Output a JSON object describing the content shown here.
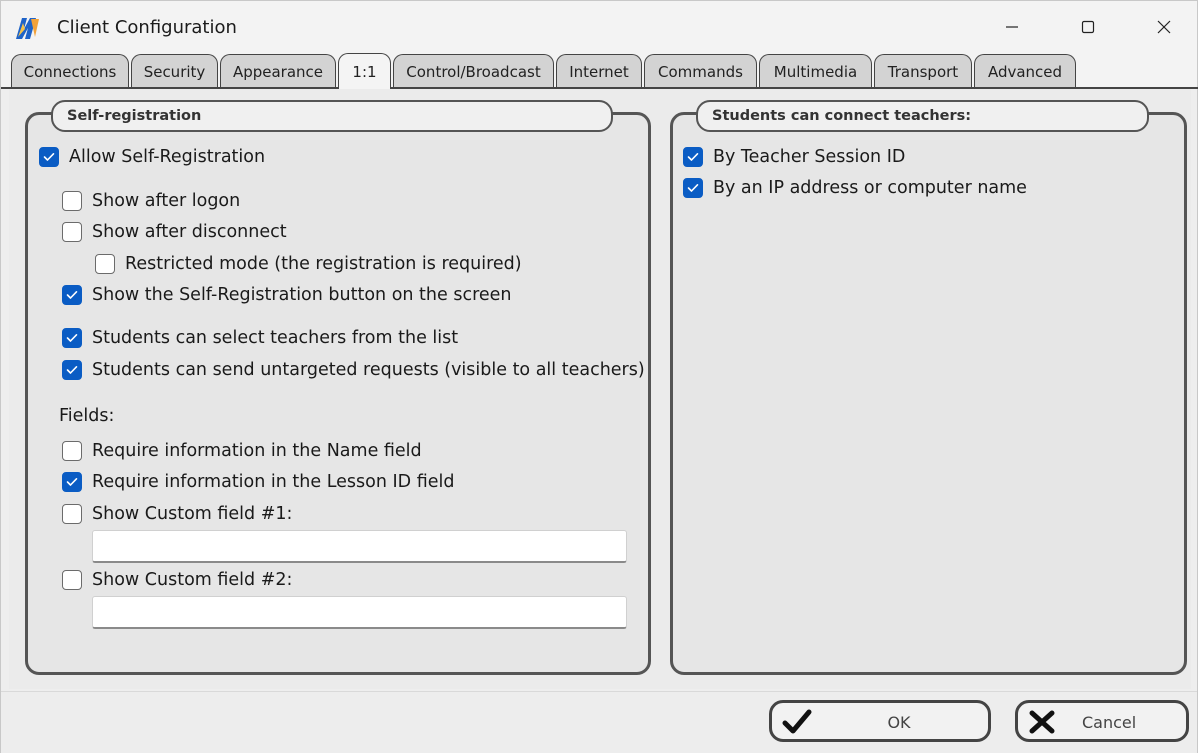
{
  "window": {
    "title": "Client Configuration",
    "controls": {
      "minimize": "minimize-icon",
      "maximize": "maximize-icon",
      "close": "close-icon"
    }
  },
  "tabs": [
    {
      "label": "Connections",
      "active": false
    },
    {
      "label": "Security",
      "active": false
    },
    {
      "label": "Appearance",
      "active": false
    },
    {
      "label": "1:1",
      "active": true
    },
    {
      "label": "Control/Broadcast",
      "active": false
    },
    {
      "label": "Internet",
      "active": false
    },
    {
      "label": "Commands",
      "active": false
    },
    {
      "label": "Multimedia",
      "active": false
    },
    {
      "label": "Transport",
      "active": false
    },
    {
      "label": "Advanced",
      "active": false
    }
  ],
  "self_registration": {
    "title": "Self-registration",
    "allow": {
      "label": "Allow Self-Registration",
      "checked": true
    },
    "show_after_logon": {
      "label": "Show after logon",
      "checked": false
    },
    "show_after_disconnect": {
      "label": "Show after disconnect",
      "checked": false
    },
    "restricted_mode": {
      "label": "Restricted mode (the registration is required)",
      "checked": false
    },
    "show_button": {
      "label": "Show the Self-Registration button on the screen",
      "checked": true
    },
    "select_teachers": {
      "label": "Students can select teachers from the list",
      "checked": true
    },
    "untargeted_requests": {
      "label": "Students can send untargeted requests (visible to all teachers)",
      "checked": true
    },
    "fields_label": "Fields:",
    "require_name": {
      "label": "Require information in the Name field",
      "checked": false
    },
    "require_lesson": {
      "label": "Require information in the Lesson ID field",
      "checked": true
    },
    "custom1": {
      "label": "Show Custom field #1:",
      "checked": false,
      "value": ""
    },
    "custom2": {
      "label": "Show Custom field #2:",
      "checked": false,
      "value": ""
    }
  },
  "connect_teachers": {
    "title": "Students can connect teachers:",
    "by_session_id": {
      "label": "By Teacher Session ID",
      "checked": true
    },
    "by_ip": {
      "label": "By an IP address or computer name",
      "checked": true
    }
  },
  "buttons": {
    "ok": "OK",
    "cancel": "Cancel"
  },
  "colors": {
    "accent": "#0a5cc4",
    "border": "#555555",
    "tab_inactive": "#d3d3d3"
  }
}
